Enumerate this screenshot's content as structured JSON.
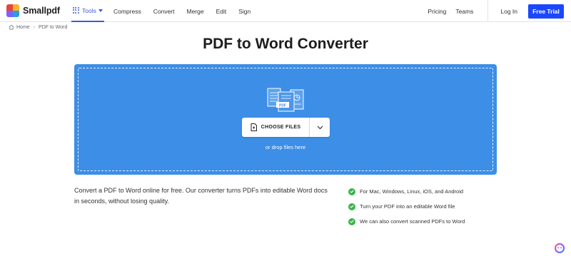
{
  "brand": {
    "name": "Smallpdf",
    "colors": [
      "#e8443a",
      "#f7b32b",
      "#7b61ff",
      "#2d9cdb"
    ]
  },
  "nav": {
    "tools_label": "Tools",
    "links": [
      "Compress",
      "Convert",
      "Merge",
      "Edit",
      "Sign"
    ],
    "right": {
      "pricing": "Pricing",
      "teams": "Teams",
      "login": "Log In",
      "trial": "Free Trial"
    }
  },
  "breadcrumb": {
    "home": "Home",
    "current": "PDF to Word"
  },
  "page": {
    "title": "PDF to Word Converter"
  },
  "upload": {
    "choose_label": "CHOOSE FILES",
    "drop_hint": "or drop files here",
    "accent": "#3d8ee6"
  },
  "description": "Convert a PDF to Word online for free. Our converter turns PDFs into editable Word docs in seconds, without losing quality.",
  "features": [
    "For Mac, Windows, Linux, iOS, and Android",
    "Turn your PDF into an editable Word file",
    "We can also convert scanned PDFs to Word"
  ],
  "icons": {
    "tools": "grid-icon",
    "home": "home-icon",
    "file": "file-upload-icon",
    "dropdown": "chevron-down-icon",
    "check": "check-circle-icon",
    "assistant": "assistant-icon"
  },
  "colors": {
    "primary": "#1a47ff",
    "check": "#3bb54a",
    "tools": "#3b5bdb"
  }
}
